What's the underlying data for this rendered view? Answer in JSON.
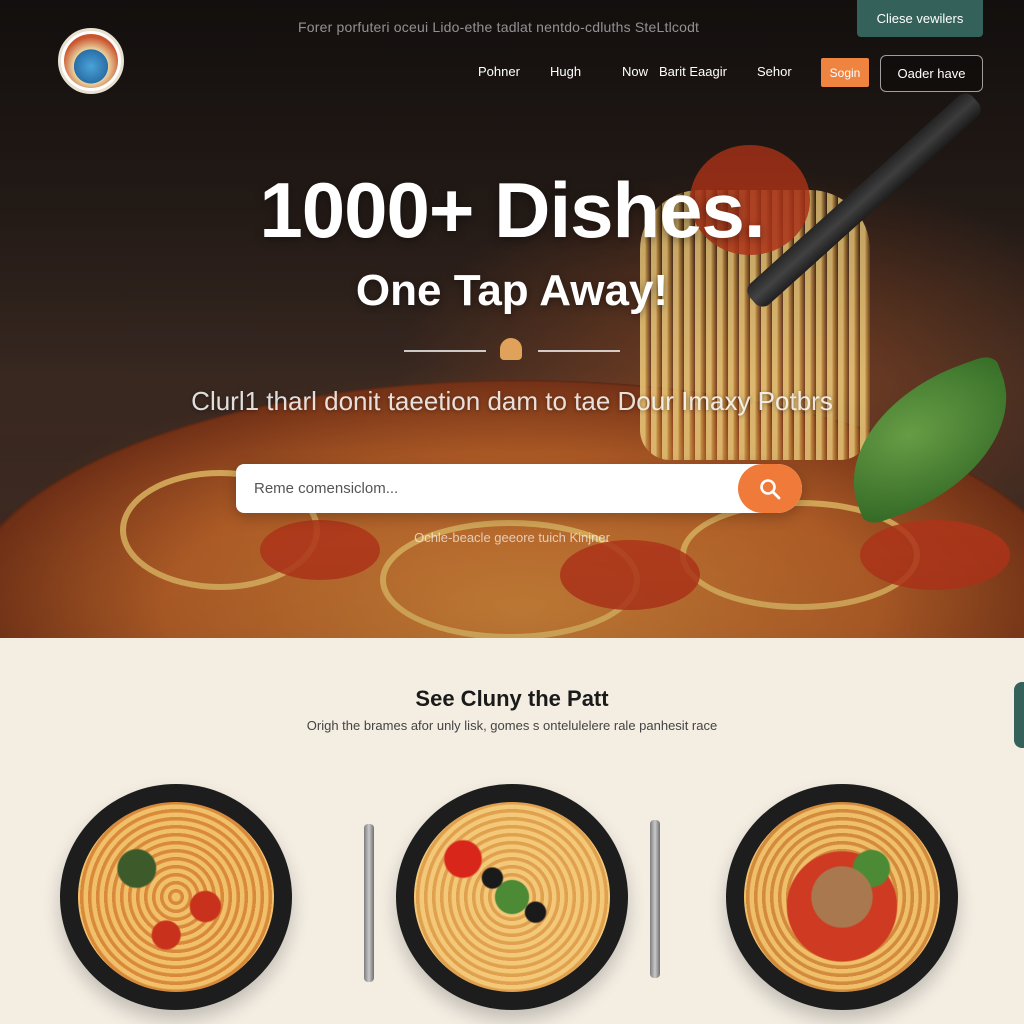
{
  "topbar": {
    "text": "Forer porfuteri oceui  Lido-ethe tadlat nentdo-cdluths      SteLtlcodt"
  },
  "corner_button": {
    "label": "Cliese vewilers"
  },
  "nav": {
    "items": [
      {
        "label": "Pohner"
      },
      {
        "label": "Hugh"
      },
      {
        "label": "Now"
      },
      {
        "label": "Barit Eaagir"
      },
      {
        "label": "Sehor"
      }
    ],
    "login_label": "Sogin",
    "order_label": "Oader have"
  },
  "hero": {
    "title": "1000+ Dishes.",
    "subtitle": "One Tap Away!",
    "tagline": "Clurl1 tharl donit taeetion dam to tae Dour Imaxy Potbrs",
    "hint": "Ochle-beacle geeore tuich Kinjner"
  },
  "search": {
    "placeholder": "Reme comensiclom...",
    "value": ""
  },
  "section": {
    "title": "See Cluny the Patt",
    "subtitle": "Origh the brames afor unly lisk, gomes s ontelulelere rale panhesit race"
  },
  "icons": {
    "logo": "restaurant-logo-icon",
    "search": "search-icon",
    "fork": "fork-icon",
    "knife": "knife-icon"
  },
  "colors": {
    "accent_orange": "#ef7a3a",
    "accent_teal": "#34625a",
    "section_bg": "#f3ede2"
  }
}
